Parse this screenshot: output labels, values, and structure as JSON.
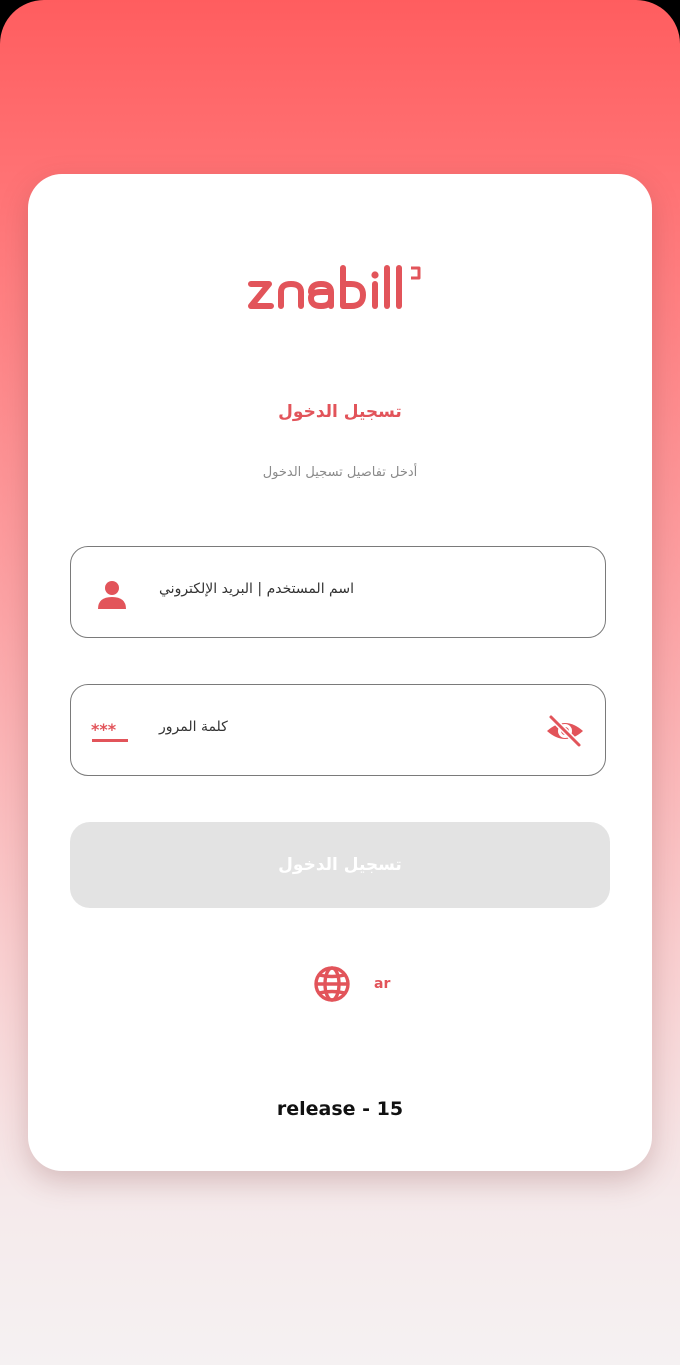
{
  "brand": {
    "logo_text": "znabill",
    "accent_color": "#e2545a"
  },
  "login": {
    "title": "تسجيل الدخول",
    "subtitle": "أدخل تفاصيل تسجيل الدخول",
    "username_placeholder": "اسم المستخدم | البريد الإلكتروني",
    "password_placeholder": "كلمة المرور",
    "submit_label": "تسجيل الدخول",
    "submit_state": "disabled"
  },
  "icons": {
    "username": "user-icon",
    "password": "password-asterisks-icon",
    "visibility": "eye-slash-icon",
    "language": "globe-icon"
  },
  "language": {
    "code": "ar"
  },
  "footer": {
    "release": "release - 15"
  }
}
